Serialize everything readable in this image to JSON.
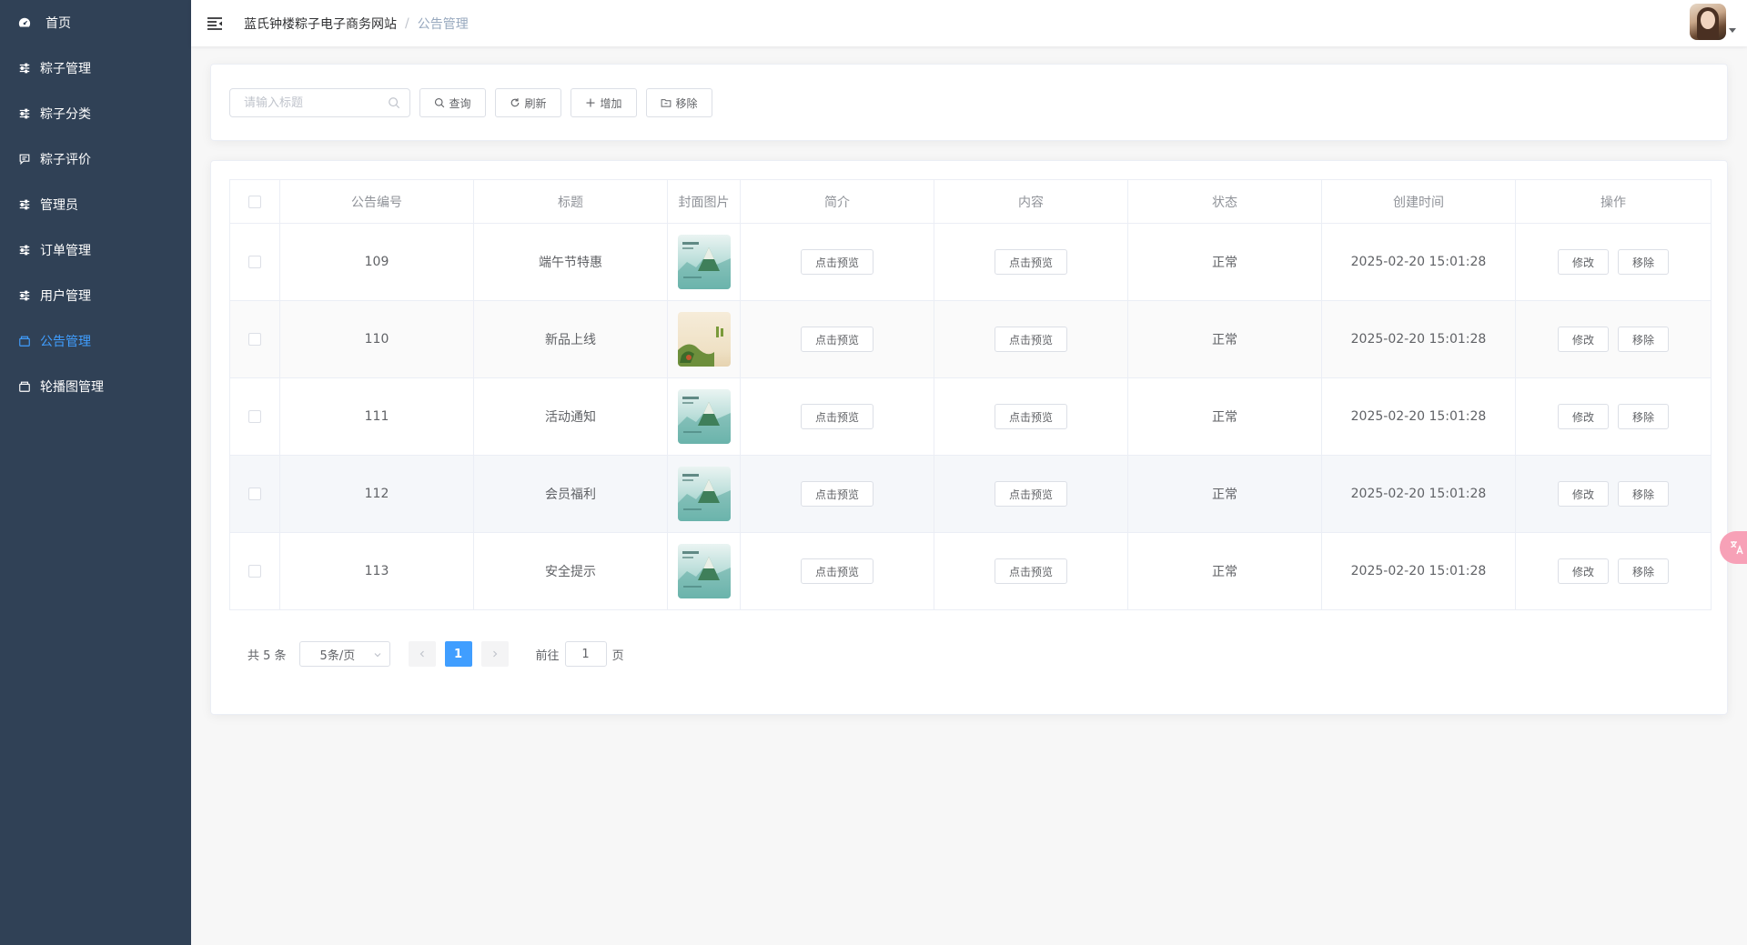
{
  "sidebar": {
    "items": [
      {
        "label": "首页",
        "icon": "dashboard-icon",
        "active": false
      },
      {
        "label": "粽子管理",
        "icon": "sliders-icon",
        "active": false
      },
      {
        "label": "粽子分类",
        "icon": "sliders-icon",
        "active": false
      },
      {
        "label": "粽子评价",
        "icon": "comment-icon",
        "active": false
      },
      {
        "label": "管理员",
        "icon": "sliders-icon",
        "active": false
      },
      {
        "label": "订单管理",
        "icon": "sliders-icon",
        "active": false
      },
      {
        "label": "用户管理",
        "icon": "sliders-icon",
        "active": false
      },
      {
        "label": "公告管理",
        "icon": "box-icon",
        "active": true
      },
      {
        "label": "轮播图管理",
        "icon": "box-icon",
        "active": false
      }
    ]
  },
  "header": {
    "breadcrumb_home": "蓝氏钟楼粽子电子商务网站",
    "breadcrumb_sep": "/",
    "breadcrumb_current": "公告管理"
  },
  "filter": {
    "search_placeholder": "请输入标题",
    "search_value": "",
    "btn_query": "查询",
    "btn_refresh": "刷新",
    "btn_add": "增加",
    "btn_remove": "移除"
  },
  "table": {
    "columns": [
      "公告编号",
      "标题",
      "封面图片",
      "简介",
      "内容",
      "状态",
      "创建时间",
      "操作"
    ],
    "preview_label": "点击预览",
    "edit_label": "修改",
    "delete_label": "移除",
    "rows": [
      {
        "id": "109",
        "title": "端午节特惠",
        "cover": "teal",
        "status": "正常",
        "created": "2025-02-20 15:01:28"
      },
      {
        "id": "110",
        "title": "新品上线",
        "cover": "beige",
        "status": "正常",
        "created": "2025-02-20 15:01:28"
      },
      {
        "id": "111",
        "title": "活动通知",
        "cover": "teal",
        "status": "正常",
        "created": "2025-02-20 15:01:28"
      },
      {
        "id": "112",
        "title": "会员福利",
        "cover": "teal",
        "status": "正常",
        "created": "2025-02-20 15:01:28"
      },
      {
        "id": "113",
        "title": "安全提示",
        "cover": "teal",
        "status": "正常",
        "created": "2025-02-20 15:01:28"
      }
    ]
  },
  "pagination": {
    "total_text": "共 5 条",
    "page_size": "5条/页",
    "current_page": "1",
    "goto_prefix": "前往",
    "goto_value": "1",
    "goto_suffix": "页"
  },
  "colors": {
    "sidebar_bg": "#304156",
    "active": "#409eff",
    "float_bubble": "#f7a1b7"
  }
}
